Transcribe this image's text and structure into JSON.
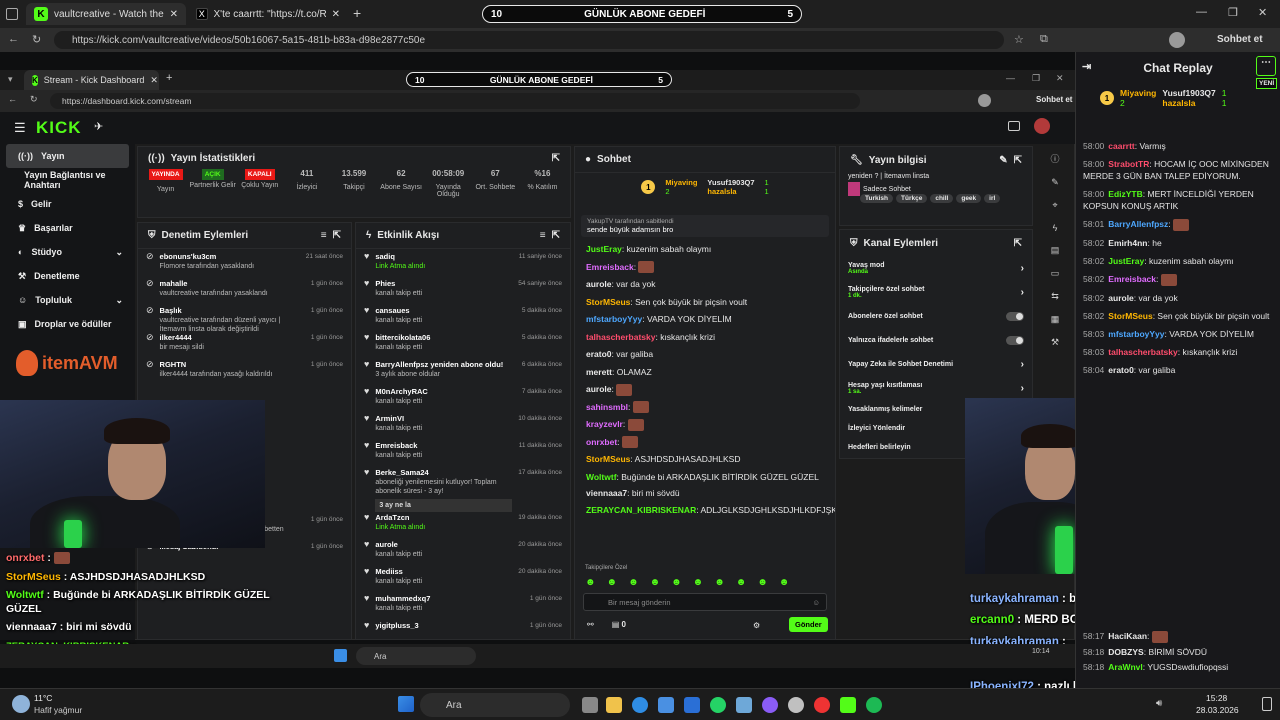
{
  "browser": {
    "tabs": [
      {
        "title": "vaultcreative - Watch the VOD"
      },
      {
        "title": "X'te caarrtt: \"https://t.co/RCTd1LD\""
      }
    ],
    "url": "https://kick.com/vaultcreative/videos/50b16067-5a15-481b-b83a-d98e2877c50e",
    "profile_action": "Sohbet et"
  },
  "goal": {
    "left": "10",
    "label": "GÜNLÜK ABONE GEDEFİ",
    "right": "5"
  },
  "inner_browser": {
    "tab_title": "Stream - Kick Dashboard",
    "url": "https://dashboard.kick.com/stream",
    "profile_action": "Sohbet et"
  },
  "kick": {
    "logo": "KICK"
  },
  "sidebar": {
    "items": [
      {
        "label": "Yayın"
      },
      {
        "label": "Yayın Bağlantısı ve Anahtarı"
      },
      {
        "label": "Gelir"
      },
      {
        "label": "Başarılar"
      },
      {
        "label": "Stüdyo"
      },
      {
        "label": "Denetleme"
      },
      {
        "label": "Topluluk"
      },
      {
        "label": "Droplar ve ödüller"
      }
    ],
    "brand": "itemAVM"
  },
  "stats": {
    "title": "Yayın İstatistikleri",
    "items": [
      {
        "value": "YAYINDA",
        "label": "Yayın"
      },
      {
        "value": "AÇIK",
        "label": "Partnerlik Gelir"
      },
      {
        "value": "KAPALI",
        "label": "Çoklu Yayın"
      },
      {
        "value": "411",
        "label": "İzleyici"
      },
      {
        "value": "13.599",
        "label": "Takipçi"
      },
      {
        "value": "62",
        "label": "Abone Sayısı"
      },
      {
        "value": "00:58:09",
        "label": "Yayında Olduğu"
      },
      {
        "value": "67",
        "label": "Ort. Sohbete"
      },
      {
        "value": "%16",
        "label": "% Katılım"
      }
    ]
  },
  "moderation": {
    "title": "Denetim Eylemleri",
    "items": [
      {
        "user": "ebonuns'ku3cm",
        "detail": "Flomore tarafından yasaklandı",
        "time": "21 saat önce"
      },
      {
        "user": "mahalle",
        "detail": "vaultcreative tarafından yasaklandı",
        "time": "1 gün önce"
      },
      {
        "user": "Başlık",
        "detail": "vaultcreative tarafından düzenli yayıcı | İtemavm linsta olarak değiştirildi",
        "time": "1 gün önce"
      },
      {
        "user": "ilker4444",
        "detail": "bir mesajı sildi",
        "time": "1 gün önce"
      },
      {
        "user": "RGHTN",
        "detail": "ilker4444 tarafından yasağı kaldırıldı",
        "time": "1 gün önce"
      },
      {
        "user": "nomercymecid",
        "detail": "tarafından 5 dakika süreliğine sohbetten",
        "time": "1 gün önce"
      },
      {
        "user": "Mesaj Sabitlendi",
        "detail": "",
        "time": "1 gün önce"
      }
    ]
  },
  "activity": {
    "title": "Etkinlik Akışı",
    "items": [
      {
        "user": "sadiq",
        "detail": "Link Atma alındı",
        "time": "11 saniye önce"
      },
      {
        "user": "Phies",
        "detail": "kanalı takip etti",
        "time": "54 saniye önce"
      },
      {
        "user": "cansaues",
        "detail": "kanalı takip etti",
        "time": "5 dakika önce"
      },
      {
        "user": "bittercikolata06",
        "detail": "kanalı takip etti",
        "time": "5 dakika önce"
      },
      {
        "user": "BarryAllenfpsz yeniden abone oldu!",
        "detail": "3 aylık abone oldular",
        "time": "6 dakika önce"
      },
      {
        "user": "M0nArchyRAC",
        "detail": "kanalı takip etti",
        "time": "7 dakika önce"
      },
      {
        "user": "ArminVI",
        "detail": "kanalı takip etti",
        "time": "10 dakika önce"
      },
      {
        "user": "Emreisback",
        "detail": "kanalı takip etti",
        "time": "11 dakika önce"
      },
      {
        "user": "Berke_Sama24",
        "detail": "aboneliği yenilemesini kutluyor! Toplam abonelik süresi - 3 ay!",
        "time": "17 dakika önce",
        "extra": "3 ay ne la"
      },
      {
        "user": "ArdaTzcn",
        "detail": "Link Atma alındı",
        "time": "19 dakika önce"
      },
      {
        "user": "aurole",
        "detail": "kanalı takip etti",
        "time": "20 dakika önce"
      },
      {
        "user": "Mediiss",
        "detail": "kanalı takip etti",
        "time": "20 dakika önce"
      },
      {
        "user": "muhammedxq7",
        "detail": "kanalı takip etti",
        "time": "1 gün önce"
      },
      {
        "user": "yigitpluss_3",
        "detail": "",
        "time": "1 gün önce"
      }
    ]
  },
  "chat": {
    "title": "Sohbet",
    "top1": {
      "name": "Miyaving",
      "count": "2"
    },
    "top2": {
      "name": "Yusuf1903Q7",
      "count": "1"
    },
    "top3": {
      "name": "hazalsla",
      "count": "1"
    },
    "pinned_by": "YakupTV tarafından sabitlendi",
    "pinned_msg": "sende büyük adamsın bro",
    "messages": [
      {
        "user": "JustEray",
        "color": "#53fc18",
        "text": "kuzenim sabah olaymı"
      },
      {
        "user": "Emreisback",
        "color": "#e06cff",
        "text": ""
      },
      {
        "user": "aurole",
        "color": "#e8e8e8",
        "text": "var da yok"
      },
      {
        "user": "StorMSeus",
        "color": "#ffb703",
        "text": "Sen çok büyük bir piçsin voult"
      },
      {
        "user": "mfstarboyYyy",
        "color": "#4ea8ff",
        "text": "VARDA YOK DİYELİM"
      },
      {
        "user": "talhascherbatsky",
        "color": "#ff4d6d",
        "text": "kıskançlık krizi"
      },
      {
        "user": "erato0",
        "color": "#e8e8e8",
        "text": "var galiba"
      },
      {
        "user": "merett",
        "color": "#e8e8e8",
        "text": "OLAMAZ"
      },
      {
        "user": "aurole",
        "color": "#e8e8e8",
        "text": ""
      },
      {
        "user": "sahinsmbl",
        "color": "#e06cff",
        "text": ""
      },
      {
        "user": "krayzevlr",
        "color": "#e06cff",
        "text": ""
      },
      {
        "user": "onrxbet",
        "color": "#e06cff",
        "text": ""
      },
      {
        "user": "StorMSeus",
        "color": "#ffb703",
        "text": "ASJHDSDJHASADJHLKSD"
      },
      {
        "user": "Woltwtf",
        "color": "#53fc18",
        "text": "Buğünde bi ARKADAŞLIK BİTİRDİK GÜZEL GÜZEL"
      },
      {
        "user": "viennaaa7",
        "color": "#e8e8e8",
        "text": "biri mi sövdü"
      },
      {
        "user": "ZERAYCAN_KIBRISKENAR",
        "color": "#53fc18",
        "text": "ADLJGLKSDJGHLKSDJHLKDFJŞKLFJFGŞ"
      }
    ],
    "mode": "Takipçilere Özel",
    "placeholder": "Bir mesaj gönderin",
    "send": "Gönder",
    "stats": "0"
  },
  "info": {
    "title": "Yayın bilgisi",
    "stream_title": "yeniden ? | İtemavm linsta",
    "category": "Sadece Sohbet",
    "tags": [
      "Turkish",
      "Türkçe",
      "chill",
      "geek",
      "irl"
    ]
  },
  "channel_actions": {
    "title": "Kanal Eylemleri",
    "items": [
      {
        "label": "Yavaş mod",
        "sub": "Asında"
      },
      {
        "label": "Takipçilere özel sohbet",
        "sub": "1 dk."
      },
      {
        "label": "Abonelere özel sohbet",
        "sub": ""
      },
      {
        "label": "Yalnızca ifadelerle sohbet",
        "sub": ""
      },
      {
        "label": "Yapay Zeka ile Sohbet Denetimi",
        "sub": ""
      },
      {
        "label": "Hesap yaşı kısıtlaması",
        "sub": "1 sa."
      },
      {
        "label": "Yasaklanmış kelimeler",
        "sub": ""
      },
      {
        "label": "İzleyici Yönlendir",
        "sub": ""
      },
      {
        "label": "Hedefleri belirleyin",
        "sub": ""
      }
    ]
  },
  "replay": {
    "title": "Chat Replay",
    "badge": "YENİ",
    "top1": {
      "name": "Miyaving",
      "count": "2"
    },
    "top2": {
      "name": "Yusuf1903Q7",
      "count": "1"
    },
    "top3": {
      "name": "hazalsla",
      "count": "1"
    },
    "messages": [
      {
        "time": "58:00",
        "user": "caarrtt",
        "color": "#ff4d6d",
        "text": "Varmış"
      },
      {
        "time": "58:00",
        "user": "StrabotTR",
        "color": "#ff4d6d",
        "text": "HOCAM İÇ OOC MİXİNGDEN MERDE 3 GÜN BAN TALEP EDİYORUM."
      },
      {
        "time": "58:00",
        "user": "EdizYTB",
        "color": "#53fc18",
        "text": "MERT İNCELDİĞİ YERDEN KOPSUN KONUŞ ARTIK"
      },
      {
        "time": "58:01",
        "user": "BarryAllenfpsz",
        "color": "#4ea8ff",
        "text": ""
      },
      {
        "time": "58:02",
        "user": "Emirh4nn",
        "color": "#e8e8e8",
        "text": "he"
      },
      {
        "time": "58:02",
        "user": "JustEray",
        "color": "#53fc18",
        "text": "kuzenim sabah olaymı"
      },
      {
        "time": "58:02",
        "user": "Emreisback",
        "color": "#e06cff",
        "text": ""
      },
      {
        "time": "58:02",
        "user": "aurole",
        "color": "#e8e8e8",
        "text": "var da yok"
      },
      {
        "time": "58:02",
        "user": "StorMSeus",
        "color": "#ffb703",
        "text": "Sen çok büyük bir piçsin voult"
      },
      {
        "time": "58:03",
        "user": "mfstarboyYyy",
        "color": "#4ea8ff",
        "text": "VARDA YOK DİYELİM"
      },
      {
        "time": "58:03",
        "user": "talhascherbatsky",
        "color": "#ff4d6d",
        "text": "kıskançlık krizi"
      },
      {
        "time": "58:04",
        "user": "erato0",
        "color": "#e8e8e8",
        "text": "var galiba"
      }
    ],
    "bottom": [
      {
        "time": "58:17",
        "user": "HaciKaan",
        "color": "#e8e8e8",
        "text": ""
      },
      {
        "time": "58:18",
        "user": "DOBZYS",
        "color": "#e8e8e8",
        "text": "BİRİMİ SÖVDÜ"
      },
      {
        "time": "58:18",
        "user": "AraWnvl",
        "color": "#53fc18",
        "text": "YUGSDswdiufiopqssi"
      }
    ]
  },
  "overlay_left": [
    {
      "user": "onrxbet",
      "text": ""
    },
    {
      "user": "StorMSeus",
      "text": "ASJHDSDJHASADJHLKSD"
    },
    {
      "user": "Woltwtf",
      "text": "Buğünde bi ARKADAŞLIK BİTİRDİK GÜZEL GÜZEL"
    },
    {
      "user": "viennaaa7",
      "text": "biri mi sövdü"
    },
    {
      "user": "ZERAYCAN_KIBRISKENAR",
      "text": "ADLJGLKSDJGHLKSDJHLKDFJŞKLFJFGŞ"
    }
  ],
  "overlay_right": [
    {
      "user": "turkaykahraman",
      "text": "bu orospuluk ekinde varsin anlik ya"
    },
    {
      "user": "ercann0",
      "text": "MERD BOOKU YEDİ AQ ASDASDA"
    },
    {
      "user": "turkaykahraman",
      "text": ""
    },
    {
      "user": "IPhoenixI72",
      "text": "nazlı kuzen"
    }
  ],
  "taskbar": {
    "weather_temp": "11°C",
    "weather_desc": "Hafif yağmur",
    "search": "Ara",
    "time": "15:28",
    "date": "28.03.2026",
    "inner_search": "Ara",
    "inner_time": "10:14"
  },
  "colors": {
    "accent": "#53fc18",
    "live": "#e91916"
  }
}
